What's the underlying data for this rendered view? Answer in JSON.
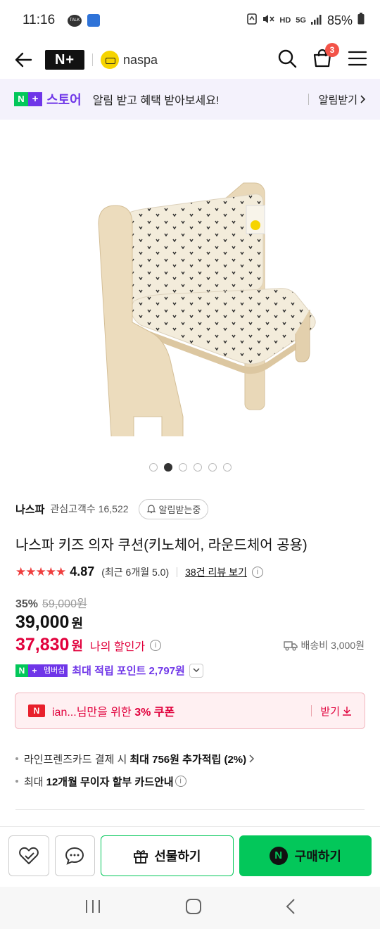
{
  "status_bar": {
    "time": "11:16",
    "battery": "85%",
    "hd_label": "HD",
    "network": "5G"
  },
  "nav": {
    "nplus_logo": "N+",
    "brand": "naspa",
    "cart_count": "3"
  },
  "store_banner": {
    "badge": "N+",
    "store_word": "스토어",
    "text": "알림 받고 혜택 받아보세요!",
    "action": "알림받기"
  },
  "gallery": {
    "total_images": 6,
    "active_index": 1
  },
  "seller": {
    "name": "나스파",
    "followers_label": "관심고객수 16,522",
    "alert_chip": "알림받는중"
  },
  "product": {
    "title": "나스파 키즈 의자 쿠션(키노체어, 라운드체어 공용)",
    "rating_stars": "★★★★★",
    "rating": "4.87",
    "rating_recent": "(최근 6개월 5.0)",
    "reviews_link": "38건 리뷰 보기",
    "discount_pct": "35%",
    "original_price": "59,000원",
    "price": "39,000",
    "price_unit": "원",
    "my_price": "37,830",
    "my_price_unit": "원",
    "my_price_label": "나의 할인가",
    "shipping": "배송비 3,000원"
  },
  "points": {
    "member_label": "멤버십",
    "text": "최대 적립 포인트 2,797원"
  },
  "coupon": {
    "prefix": "ian...님만을 위한 ",
    "highlight": "3% 쿠폰",
    "action": "받기"
  },
  "benefits": [
    {
      "pre": "라인프렌즈카드 결제 시",
      "bold": "최대 756원 추가적립 (2%)"
    },
    {
      "pre": "최대",
      "bold": "12개월 무이자 할부 카드안내"
    }
  ],
  "actions": {
    "gift": "선물하기",
    "buy": "구매하기"
  },
  "colors": {
    "accent_green": "#03c75a",
    "accent_purple": "#6f36e8",
    "price_red": "#e1003c"
  }
}
